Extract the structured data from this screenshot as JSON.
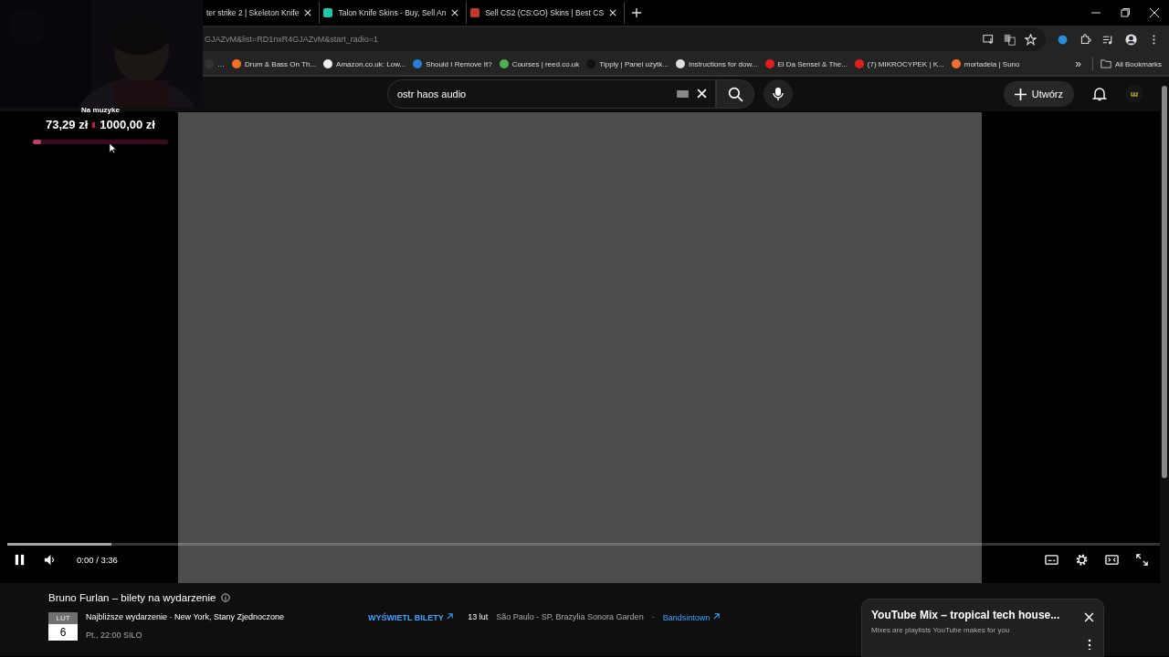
{
  "tabs": [
    {
      "title": "ter strike 2 | Skeleton Knife",
      "selected": false
    },
    {
      "title": "Talon Knife Skins - Buy, Sell An",
      "color": "#1fc9a4",
      "selected": false
    },
    {
      "title": "Sell CS2 (CS:GO) Skins | Best CS",
      "color": "#c0392b",
      "selected": false
    }
  ],
  "address": {
    "url": "GJAZvM&list=RD1nxR4GJAZvM&start_radio=1"
  },
  "bookmarks": [
    {
      "label": "…",
      "color": "#333333"
    },
    {
      "label": "Drum & Bass On Th...",
      "color": "#f26f23"
    },
    {
      "label": "Amazon.co.uk: Low...",
      "color": "#eeeeee"
    },
    {
      "label": "Should I Remove It?",
      "color": "#2a7fd4"
    },
    {
      "label": "Courses | reed.co.uk",
      "color": "#4caf50"
    },
    {
      "label": "Tipply | Panel użytk...",
      "color": "#111111"
    },
    {
      "label": "Instructions for dow...",
      "color": "#dddddd"
    },
    {
      "label": "El Da Sensei & The...",
      "color": "#e02020"
    },
    {
      "label": "(7) MIKROCYPEK | K...",
      "color": "#e02020"
    },
    {
      "label": "mortadela | Suno",
      "color": "#f07030"
    }
  ],
  "bookmarks_more": "»",
  "all_bookmarks": "All Bookmarks",
  "search": {
    "value": "ostr haos audio"
  },
  "create_button": "Utwórz",
  "donation": {
    "title": "Na muzyke",
    "current": "73,29 zł",
    "goal": "1000,00 zł",
    "level": 0.04
  },
  "player": {
    "buffered": {
      "level": 0.09
    },
    "time": "0:00 / 3:36",
    "playing": true
  },
  "event": {
    "heading": "Bruno Furlan – bilety na wydarzenie",
    "month": "LUT",
    "day": "6",
    "title": "Najbliższe wydarzenie · New York, Stany Zjednoczone",
    "when": "Pt., 22:00 SILO",
    "tickets": "WYŚWIETL BILETY",
    "next_date": "13 lut",
    "next_place": "São Paulo - SP, Brazylia Sonora Garden",
    "separator": "·",
    "next_source": "Bandsintown"
  },
  "mix": {
    "title": "YouTube Mix – tropical tech house...",
    "subtitle": "Mixes are playlists YouTube makes for you"
  }
}
